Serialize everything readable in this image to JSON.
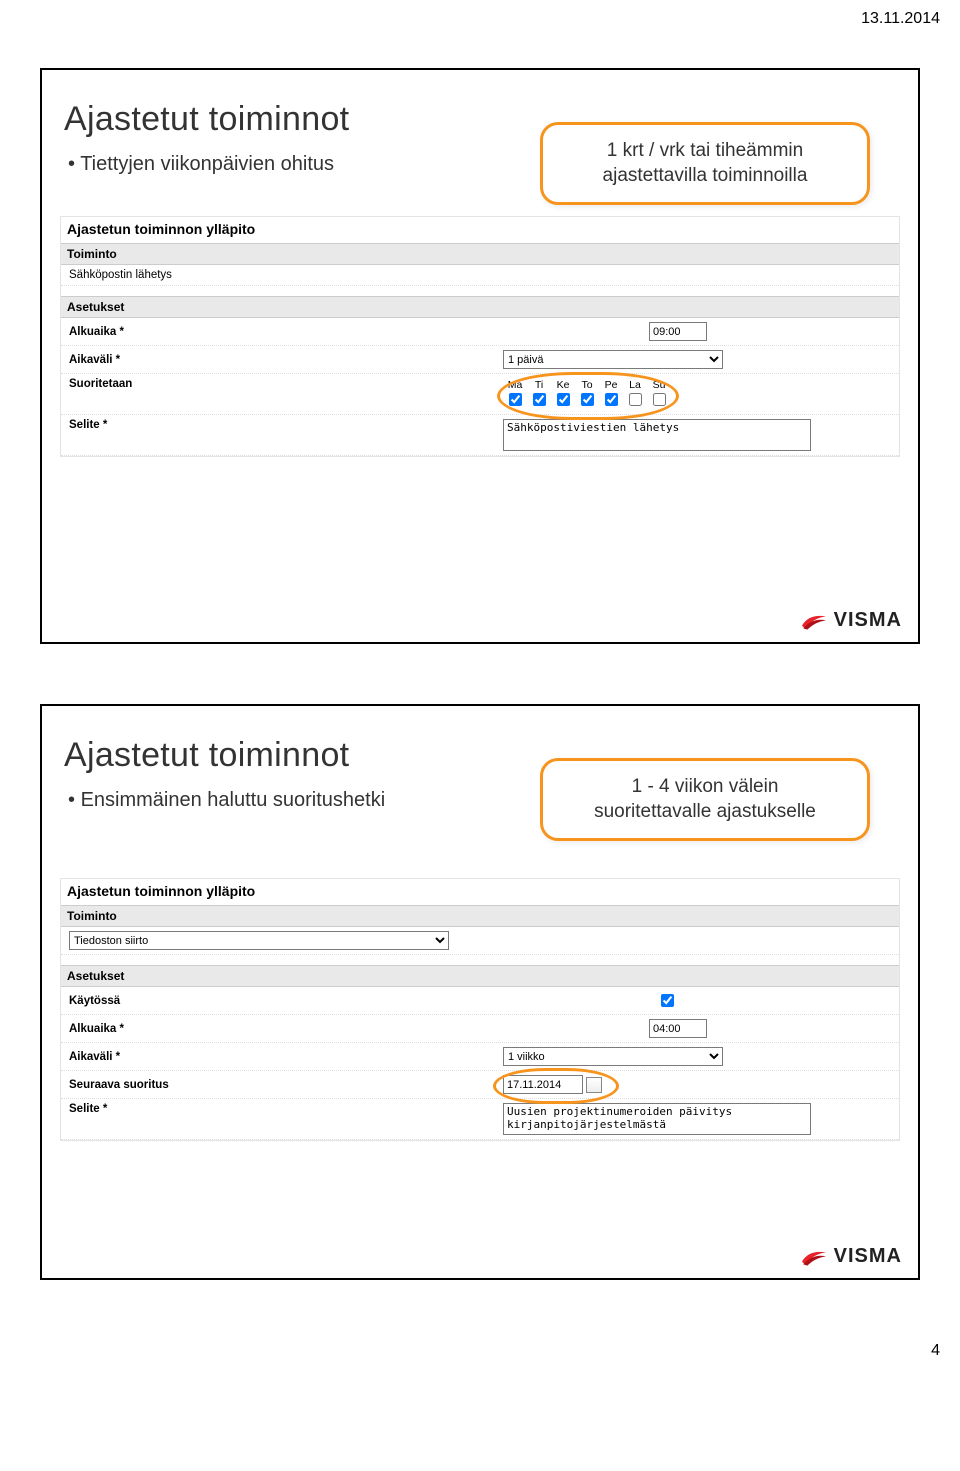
{
  "header": {
    "date": "13.11.2014"
  },
  "footer": {
    "page_number": "4"
  },
  "brand": {
    "name": "VISMA"
  },
  "slide1": {
    "title": "Ajastetut toiminnot",
    "bullet": "Tiettyjen viikonpäivien ohitus",
    "callout_line1": "1 krt / vrk tai tiheämmin",
    "callout_line2": "ajastettavilla toiminnoilla",
    "form": {
      "title": "Ajastetun toiminnon ylläpito",
      "section_toiminto": "Toiminto",
      "toiminto_value": "Sähköpostin lähetys",
      "section_asetukset": "Asetukset",
      "alkuaika_label": "Alkuaika *",
      "alkuaika_value": "09:00",
      "aikavali_label": "Aikaväli *",
      "aikavali_value": "1 päivä",
      "suoritetaan_label": "Suoritetaan",
      "days": [
        "Ma",
        "Ti",
        "Ke",
        "To",
        "Pe",
        "La",
        "Su"
      ],
      "days_checked": [
        true,
        true,
        true,
        true,
        true,
        false,
        false
      ],
      "selite_label": "Selite *",
      "selite_value": "Sähköpostiviestien lähetys"
    }
  },
  "slide2": {
    "title": "Ajastetut toiminnot",
    "bullet": "Ensimmäinen haluttu suoritushetki",
    "callout_line1": "1 - 4 viikon välein",
    "callout_line2": "suoritettavalle ajastukselle",
    "form": {
      "title": "Ajastetun toiminnon ylläpito",
      "section_toiminto": "Toiminto",
      "toiminto_value": "Tiedoston siirto",
      "section_asetukset": "Asetukset",
      "kaytossa_label": "Käytössä",
      "kaytossa_checked": true,
      "alkuaika_label": "Alkuaika *",
      "alkuaika_value": "04:00",
      "aikavali_label": "Aikaväli *",
      "aikavali_value": "1 viikko",
      "seuraava_label": "Seuraava suoritus",
      "seuraava_value": "17.11.2014",
      "selite_label": "Selite *",
      "selite_value": "Uusien projektinumeroiden päivitys kirjanpitojärjestelmästä"
    }
  }
}
